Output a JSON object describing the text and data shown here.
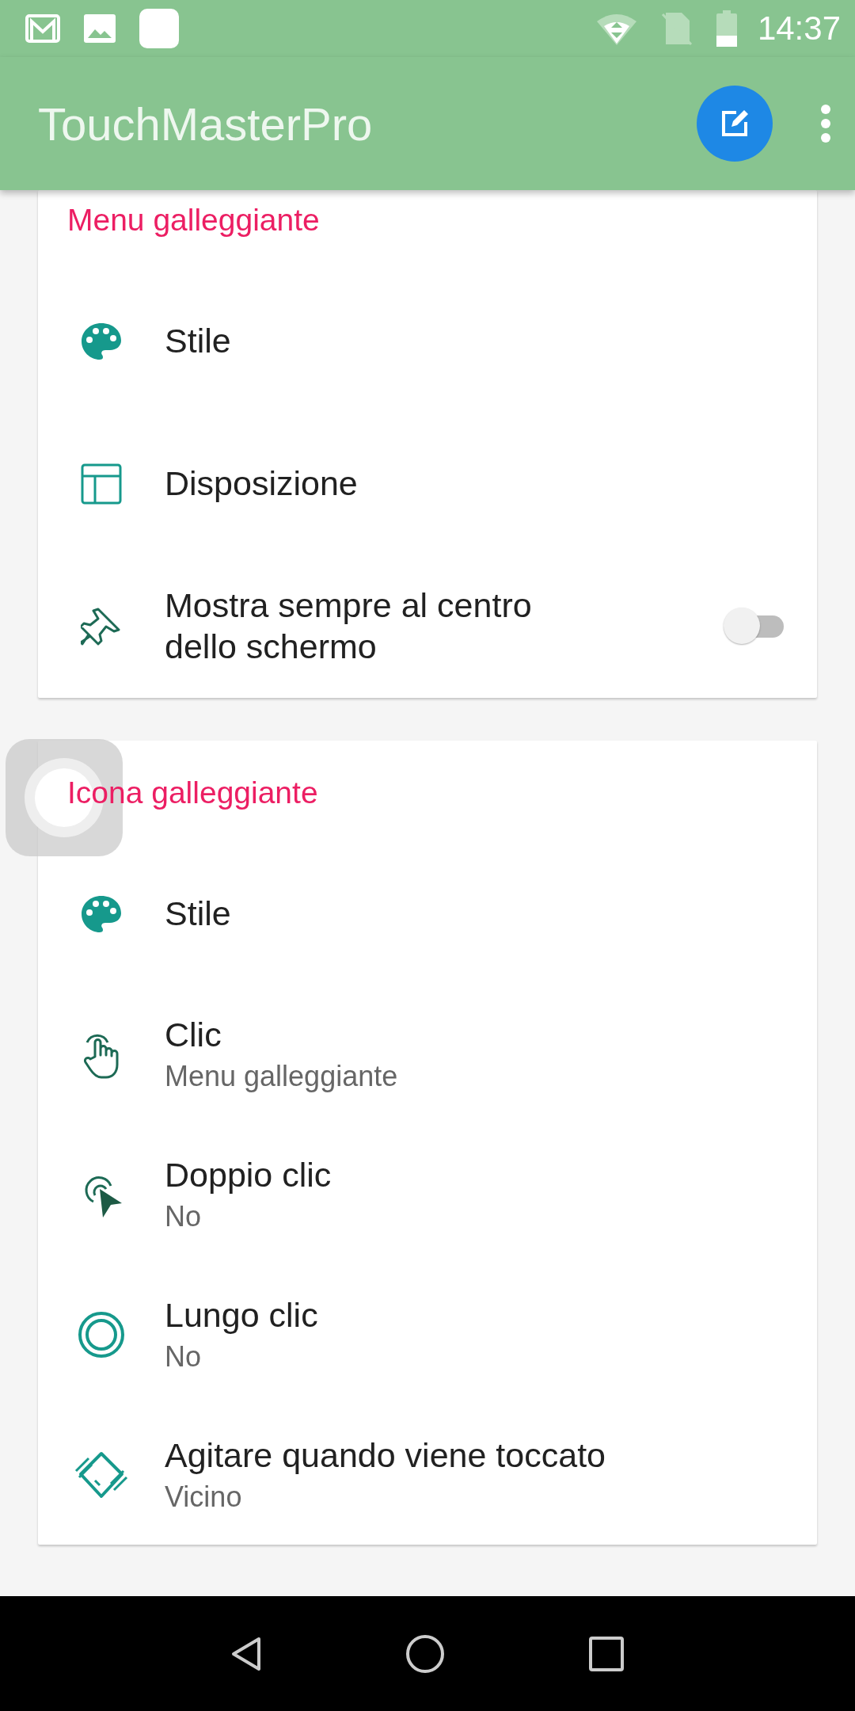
{
  "status_bar": {
    "time": "14:37"
  },
  "app_bar": {
    "title": "TouchMasterPro"
  },
  "sections": [
    {
      "header": "Menu galleggiante",
      "items": [
        {
          "kind": "setting",
          "title": "Stile"
        },
        {
          "kind": "setting",
          "title": "Disposizione"
        },
        {
          "kind": "toggle",
          "title": "Mostra sempre al centro dello schermo",
          "on": false
        }
      ]
    },
    {
      "header": "Icona galleggiante",
      "items": [
        {
          "kind": "setting",
          "title": "Stile"
        },
        {
          "kind": "setting",
          "title": "Clic",
          "summary": "Menu galleggiante"
        },
        {
          "kind": "setting",
          "title": "Doppio clic",
          "summary": "No"
        },
        {
          "kind": "setting",
          "title": "Lungo clic",
          "summary": "No"
        },
        {
          "kind": "setting",
          "title": "Agitare quando viene toccato",
          "summary": "Vicino"
        }
      ]
    }
  ]
}
